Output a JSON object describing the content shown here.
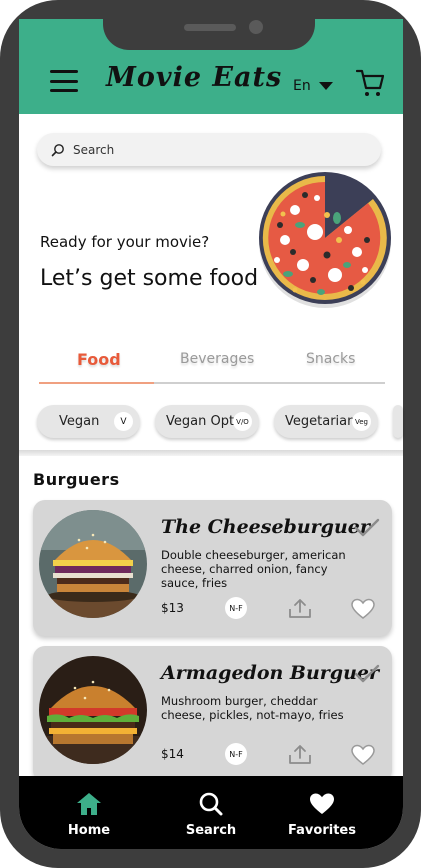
{
  "header": {
    "app_title": "Movie Eats",
    "language": "En",
    "accent_color": "#3daf8a"
  },
  "search": {
    "placeholder": "Search"
  },
  "hero": {
    "subtitle": "Ready for your movie?",
    "headline": "Let’s get some food"
  },
  "tabs": [
    {
      "label": "Food",
      "active": true
    },
    {
      "label": "Beverages",
      "active": false
    },
    {
      "label": "Snacks",
      "active": false
    }
  ],
  "filters": [
    {
      "label": "Vegan",
      "badge": "V"
    },
    {
      "label": "Vegan Opt",
      "badge": "V/O"
    },
    {
      "label": "Vegetarian",
      "badge": "Veg"
    }
  ],
  "section": {
    "title": "Burguers"
  },
  "menu_items": [
    {
      "name": "The Cheeseburguer",
      "description": "Double cheeseburger, american cheese, charred onion, fancy sauce, fries",
      "price": "$13",
      "badge": "N-F"
    },
    {
      "name": "Armagedon Burguer",
      "description": "Mushroom burger, cheddar cheese, pickles, not-mayo, fries",
      "price": "$14",
      "badge": "N-F"
    }
  ],
  "bottom_nav": [
    {
      "label": "Home",
      "icon": "home-icon",
      "active": true
    },
    {
      "label": "Search",
      "icon": "search-icon",
      "active": false
    },
    {
      "label": "Favorites",
      "icon": "heart-icon",
      "active": false
    }
  ],
  "colors": {
    "active_tab": "#e85a3a",
    "active_nav": "#3daf8a",
    "card_bg": "#d6d6d6"
  }
}
